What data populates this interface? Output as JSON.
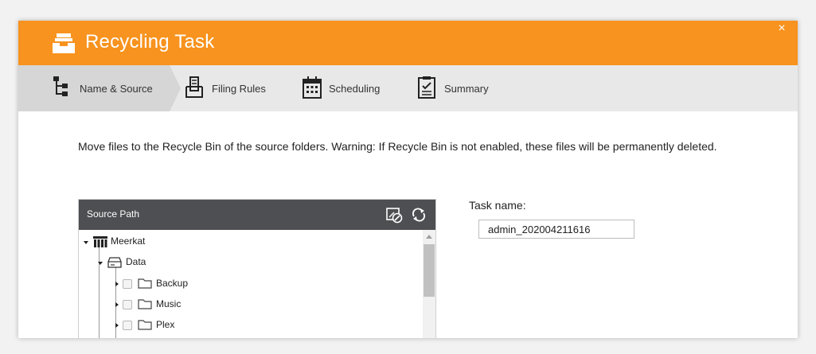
{
  "dialog": {
    "title": "Recycling Task",
    "close_label": "×"
  },
  "steps": [
    {
      "label": "Name & Source",
      "icon": "tree-hierarchy-icon",
      "active": true
    },
    {
      "label": "Filing Rules",
      "icon": "filing-tray-icon",
      "active": false
    },
    {
      "label": "Scheduling",
      "icon": "calendar-icon",
      "active": false
    },
    {
      "label": "Summary",
      "icon": "checklist-icon",
      "active": false
    }
  ],
  "warning_text": "Move files to the Recycle Bin of the source folders. Warning: If Recycle Bin is not enabled, these files will be permanently deleted.",
  "source_tree": {
    "header": "Source Path",
    "nodes": [
      {
        "label": "Meerkat",
        "type": "server",
        "expanded": true
      },
      {
        "label": "Data",
        "type": "volume",
        "expanded": true
      },
      {
        "label": "Backup",
        "type": "folder",
        "checked": false
      },
      {
        "label": "Music",
        "type": "folder",
        "checked": false
      },
      {
        "label": "Plex",
        "type": "folder",
        "checked": false
      }
    ]
  },
  "task_name": {
    "label": "Task name:",
    "value": "admin_202004211616"
  },
  "colors": {
    "accent": "#f7931e",
    "steps_bg": "#e8e8e8",
    "active_step_bg": "#d6d6d6",
    "tree_header_bg": "#4d4f52"
  }
}
